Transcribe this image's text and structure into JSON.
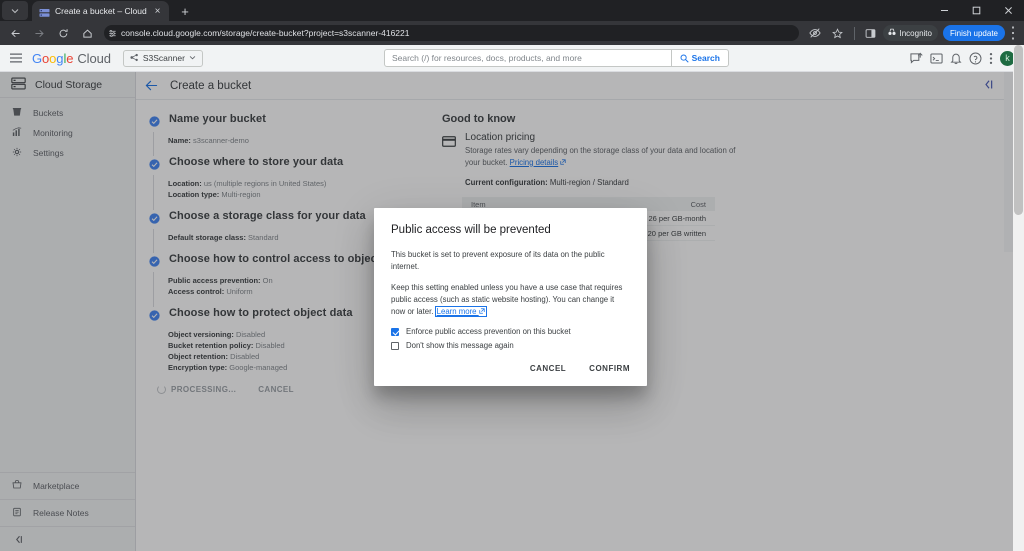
{
  "browser": {
    "tab": {
      "title": "Create a bucket – Cloud Storag",
      "favicon_name": "cloud-storage-favicon",
      "close_glyph": "×"
    },
    "newtab_glyph": "+",
    "window_controls": {
      "minimize": "–",
      "maximize": "⬜",
      "close": "✕"
    },
    "url": "console.cloud.google.com/storage/create-bucket?project=s3scanner-416221",
    "incognito_label": "Incognito",
    "finish_update_label": "Finish update",
    "kebab_glyph": "⋮"
  },
  "gcheader": {
    "logo": {
      "g1": "G",
      "o1": "o",
      "o2": "o",
      "g2": "g",
      "l1": "l",
      "e1": "e",
      "cloud": "Cloud"
    },
    "project_name": "S3Scanner",
    "search_placeholder": "Search (/) for resources, docs, products, and more",
    "search_button": "Search",
    "avatar_initial": "k"
  },
  "leftnav": {
    "title": "Cloud Storage",
    "items": [
      {
        "label": "Buckets",
        "icon": "bucket-icon"
      },
      {
        "label": "Monitoring",
        "icon": "monitoring-icon"
      },
      {
        "label": "Settings",
        "icon": "gear-icon"
      }
    ],
    "bottom": [
      {
        "label": "Marketplace",
        "icon": "marketplace-icon"
      },
      {
        "label": "Release Notes",
        "icon": "release-notes-icon"
      }
    ]
  },
  "page": {
    "title": "Create a bucket",
    "steps": [
      {
        "title": "Name your bucket",
        "details": [
          {
            "k": "Name:",
            "v": "s3scanner-demo"
          }
        ]
      },
      {
        "title": "Choose where to store your data",
        "details": [
          {
            "k": "Location:",
            "v": "us (multiple regions in United States)"
          },
          {
            "k": "Location type:",
            "v": "Multi-region"
          }
        ]
      },
      {
        "title": "Choose a storage class for your data",
        "details": [
          {
            "k": "Default storage class:",
            "v": "Standard"
          }
        ]
      },
      {
        "title": "Choose how to control access to objects",
        "details": [
          {
            "k": "Public access prevention:",
            "v": "On"
          },
          {
            "k": "Access control:",
            "v": "Uniform"
          }
        ]
      },
      {
        "title": "Choose how to protect object data",
        "details": [
          {
            "k": "Object versioning:",
            "v": "Disabled"
          },
          {
            "k": "Bucket retention policy:",
            "v": "Disabled"
          },
          {
            "k": "Object retention:",
            "v": "Disabled"
          },
          {
            "k": "Encryption type:",
            "v": "Google-managed"
          }
        ]
      }
    ],
    "processing_label": "PROCESSING...",
    "cancel_label": "CANCEL"
  },
  "info": {
    "title": "Good to know",
    "section_heading": "Location pricing",
    "paragraph_pre": "Storage rates vary depending on the storage class of your data and location of your bucket. ",
    "paragraph_link": "Pricing details",
    "config_key": "Current configuration:",
    "config_value": " Multi-region / Standard",
    "table": {
      "headers": {
        "item": "Item",
        "cost": "Cost"
      },
      "rows": [
        {
          "item": "",
          "cost": "26 per GB-month"
        },
        {
          "item": "",
          "cost": "20 per GB written"
        }
      ]
    }
  },
  "dialog": {
    "title": "Public access will be prevented",
    "paragraph1": "This bucket is set to prevent exposure of its data on the public internet.",
    "paragraph2": "Keep this setting enabled unless you have a use case that requires public access (such as static website hosting). You can change it now or later. ",
    "link": "Learn more",
    "checkbox_enforce": "Enforce public access prevention on this bucket",
    "checkbox_dontshow": "Don't show this message again",
    "cancel": "CANCEL",
    "confirm": "CONFIRM"
  },
  "colors": {
    "accent_blue": "#1a73e8",
    "check_blue": "#4285f4",
    "chrome_dark": "#202124",
    "toolbar_dark": "#35363a",
    "header_grey": "#f1f3f4"
  }
}
